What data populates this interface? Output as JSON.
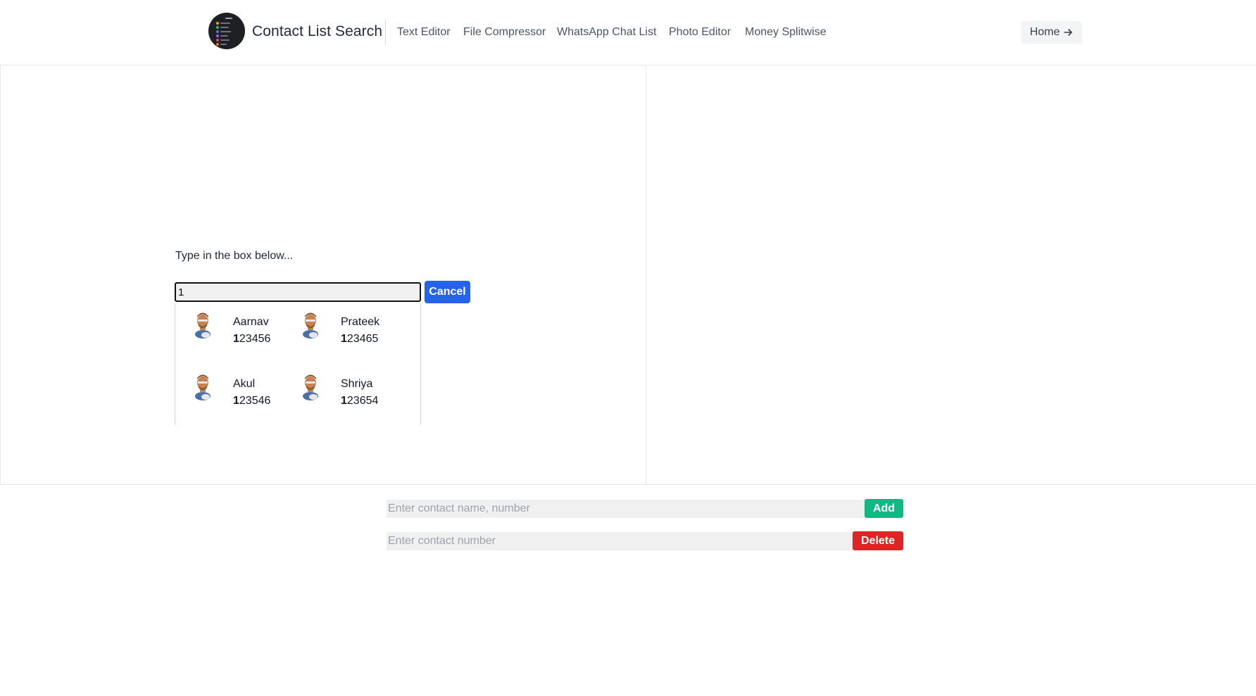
{
  "header": {
    "brand": "Contact List Search",
    "nav": [
      "Text Editor",
      "File Compressor",
      "WhatsApp Chat List",
      "Photo Editor",
      "Money Splitwise"
    ],
    "home_label": "Home",
    "home_icon": "arrow-right-icon"
  },
  "search": {
    "prompt": "Type in the box below...",
    "value": "1",
    "cancel_label": "Cancel"
  },
  "results": [
    {
      "name": "Aarnav",
      "match": "1",
      "rest": "23456",
      "icon": "person-avatar-icon"
    },
    {
      "name": "Prateek",
      "match": "1",
      "rest": "23465",
      "icon": "person-avatar-icon"
    },
    {
      "name": "Akul",
      "match": "1",
      "rest": "23546",
      "icon": "person-avatar-icon"
    },
    {
      "name": "Shriya",
      "match": "1",
      "rest": "23654",
      "icon": "person-avatar-icon"
    }
  ],
  "add_form": {
    "placeholder": "Enter contact name, number",
    "button_label": "Add",
    "button_color": "#10b981"
  },
  "delete_form": {
    "placeholder": "Enter contact number",
    "button_label": "Delete",
    "button_color": "#dc2626"
  },
  "colors": {
    "primary": "#2563eb",
    "add": "#10b981",
    "delete": "#dc2626"
  }
}
